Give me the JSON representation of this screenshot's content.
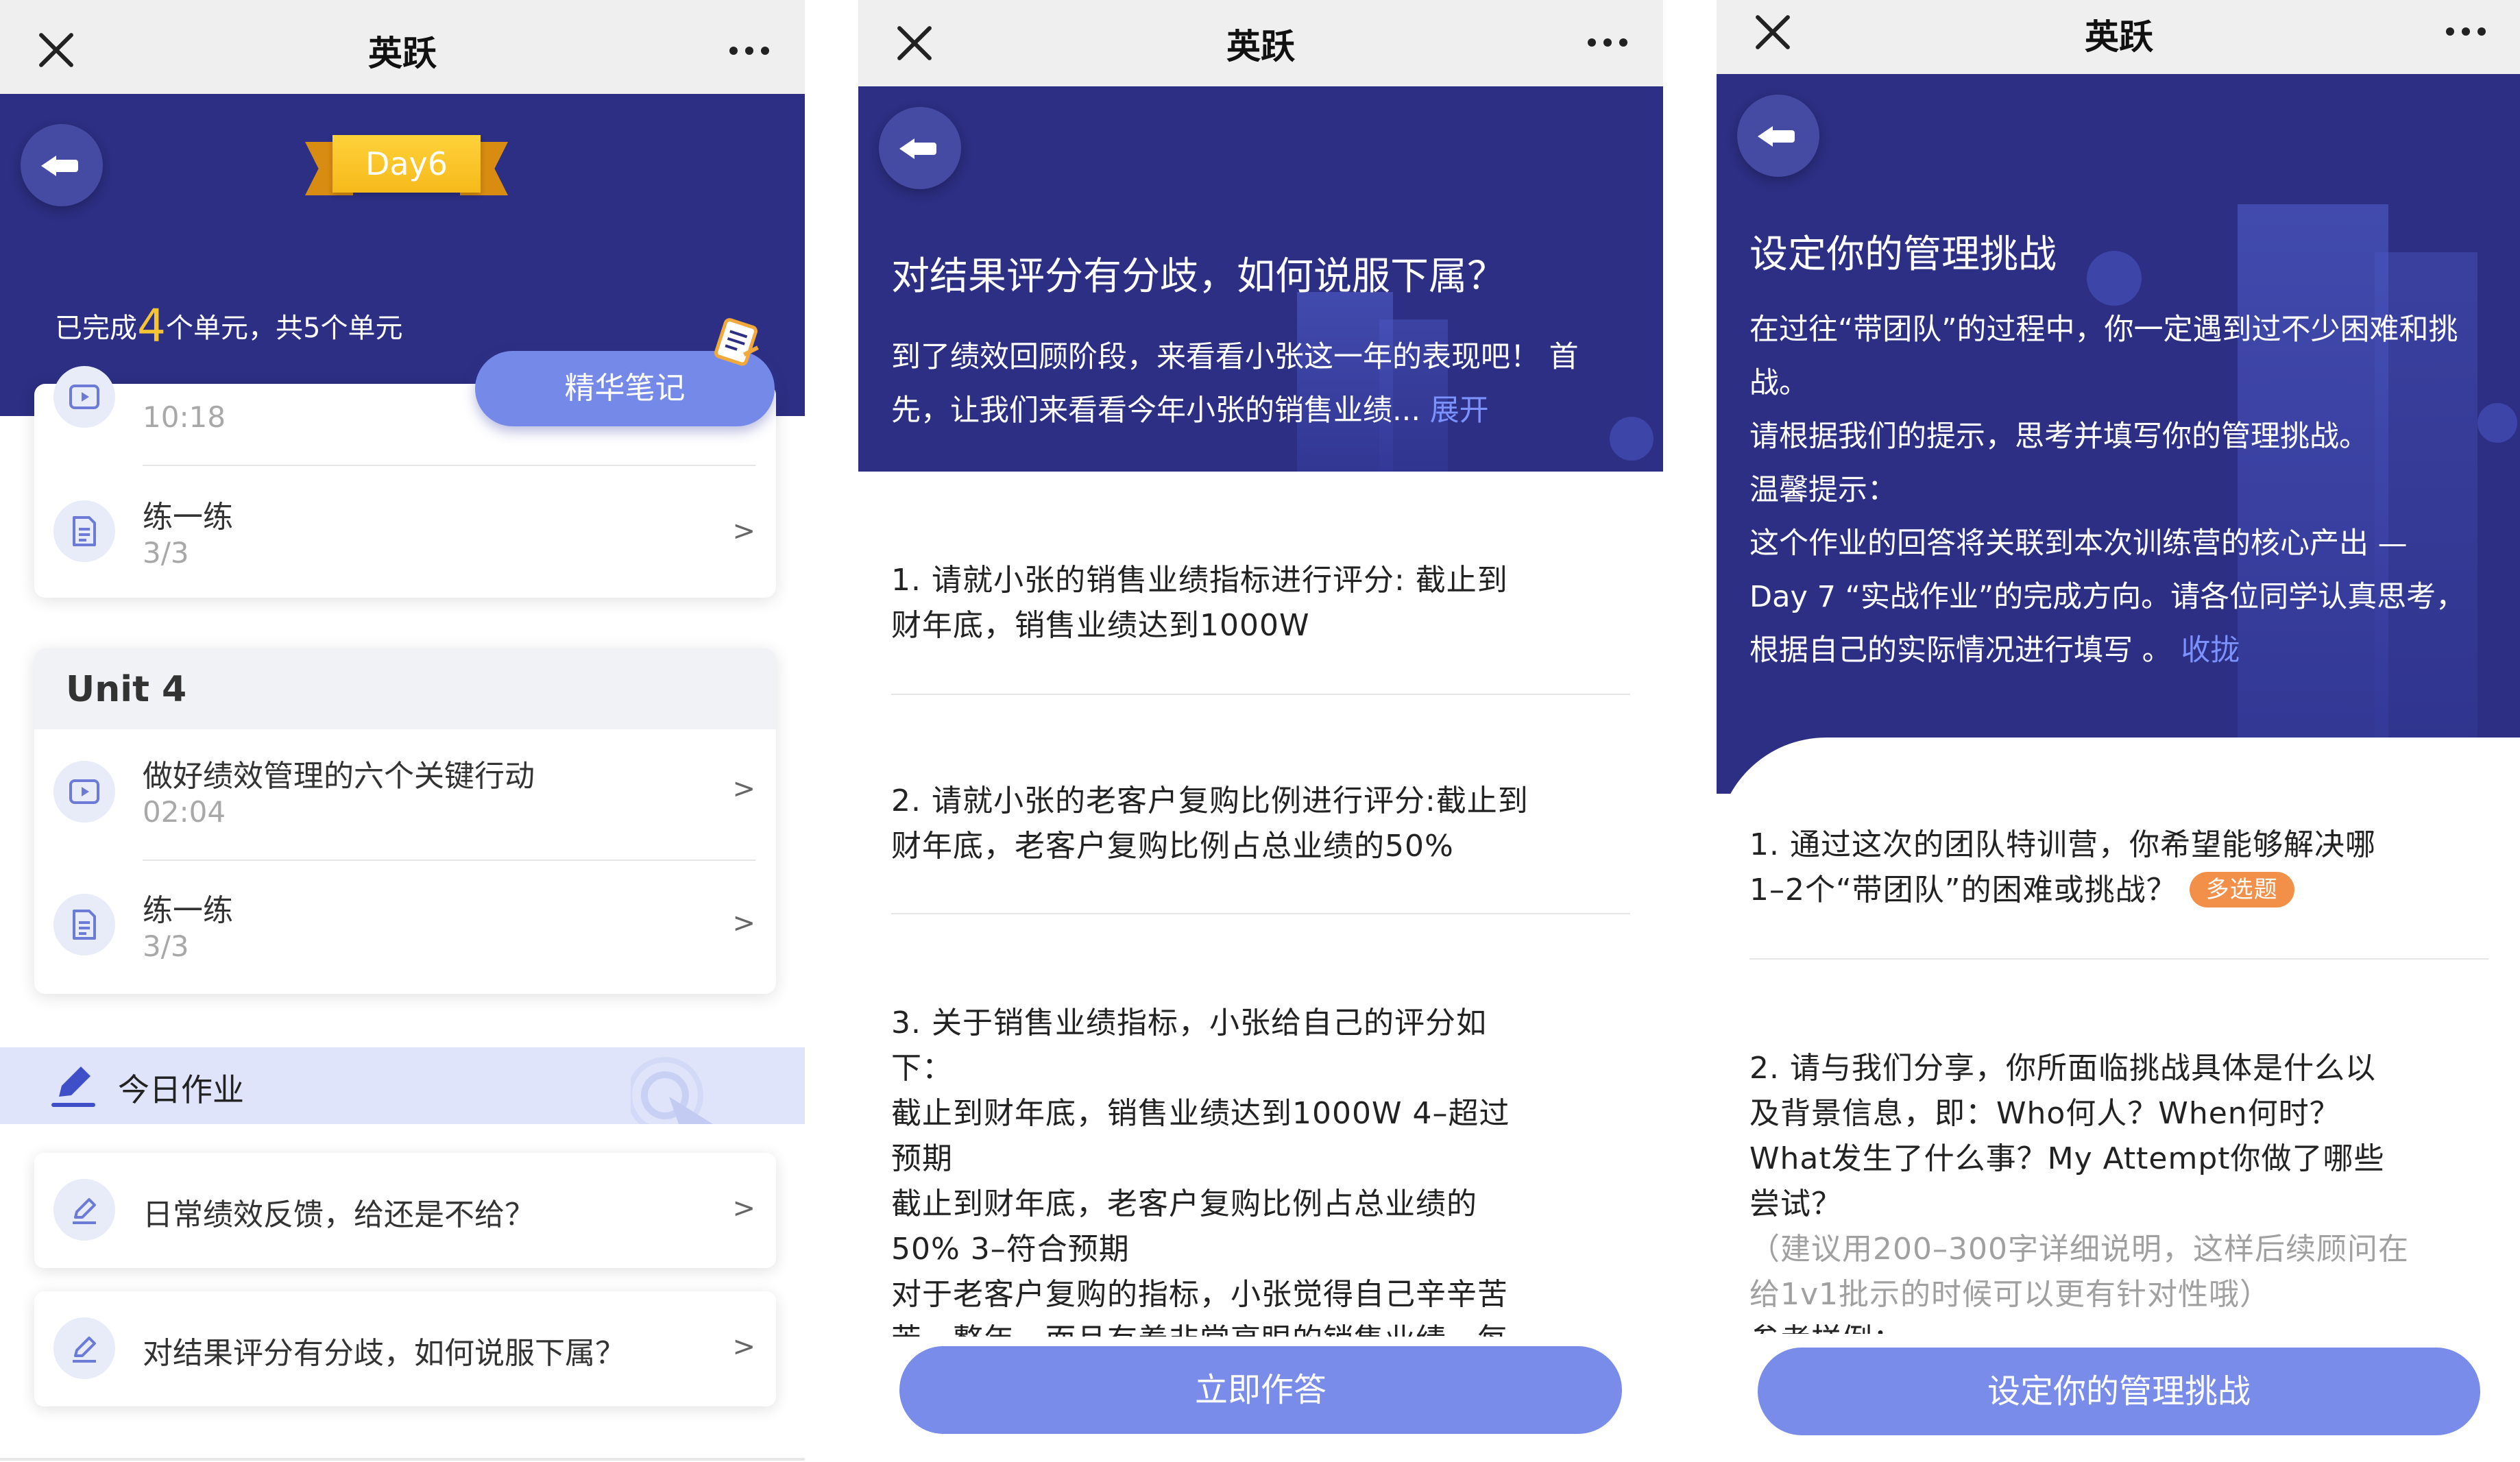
{
  "app_title": "英跃",
  "screen1": {
    "day_badge": "Day6",
    "progress": {
      "prefix": "已完成",
      "completed": "4",
      "suffix": "个单元，共5个单元"
    },
    "notes_button": "精华笔记",
    "partial_item_time": "10:18",
    "practice_item": {
      "title": "练一练",
      "progress": "3/3"
    },
    "unit4": {
      "title": "Unit 4",
      "items": [
        {
          "title": "做好绩效管理的六个关键行动",
          "sub": "02:04"
        },
        {
          "title": "练一练",
          "sub": "3/3"
        }
      ]
    },
    "homework_title": "今日作业",
    "homework": [
      {
        "title": "日常绩效反馈，给还是不给？"
      },
      {
        "title": "对结果评分有分歧，如何说服下属？"
      }
    ],
    "chevron": ">"
  },
  "screen2": {
    "title": "对结果评分有分歧，如何说服下属？",
    "intro": "到了绩效回顾阶段，来看看小张这一年的表现吧！ 首先，让我们来看看今年小张的销售业绩...",
    "expand_link": "展开",
    "q1": [
      "1. 请就小张的销售业绩指标进行评分: 截止到",
      "财年底，销售业绩达到1000W"
    ],
    "q2": [
      "2. 请就小张的老客户复购比例进行评分:截止到",
      "财年底，老客户复购比例占总业绩的50%"
    ],
    "q3": [
      "3. 关于销售业绩指标，小张给自己的评分如",
      "下：",
      "截止到财年底，销售业绩达到1000W 4–超过",
      "预期",
      "截止到财年底，老客户复购比例占总业绩的",
      "50% 3–符合预期",
      "对于老客户复购的指标，小张觉得自己辛辛苦",
      "苦一整年，而且有着非常亮眼的销售业绩，每"
    ],
    "cta": "立即作答"
  },
  "screen3": {
    "title": "设定你的管理挑战",
    "intro": [
      "在过往“带团队”的过程中，你一定遇到过不少困难和挑",
      "战。",
      "请根据我们的提示，思考并填写你的管理挑战。",
      "温馨提示：",
      "这个作业的回答将关联到本次训练营的核心产出 —",
      "Day 7 “实战作业”的完成方向。请各位同学认真思考，",
      "根据自己的实际情况进行填写 。"
    ],
    "collapse_link": "收拢",
    "q1": [
      "1. 通过这次的团队特训营，你希望能够解决哪",
      "1–2个“带团队”的困难或挑战？"
    ],
    "q1_badge": "多选题",
    "q2": [
      "2. 请与我们分享，你所面临挑战具体是什么以",
      "及背景信息，即：Who何人？When何时？",
      "What发生了什么事？My Attempt你做了哪些",
      "尝试？"
    ],
    "q2_hint": [
      "（建议用200–300字详细说明，这样后续顾问在",
      "给1v1批示的时候可以更有针对性哦）"
    ],
    "q2_more": "参考样例：",
    "cta": "设定你的管理挑战"
  },
  "colors": {
    "header_navy": "#2c2f83",
    "accent_blue": "#7a8cea",
    "ribbon_yellow": "#f6b91a",
    "badge_orange": "#f2904a"
  },
  "icons": [
    "close-icon",
    "more-icon",
    "back-arrow-icon",
    "video-icon",
    "document-icon",
    "pencil-icon",
    "notes-icon"
  ]
}
